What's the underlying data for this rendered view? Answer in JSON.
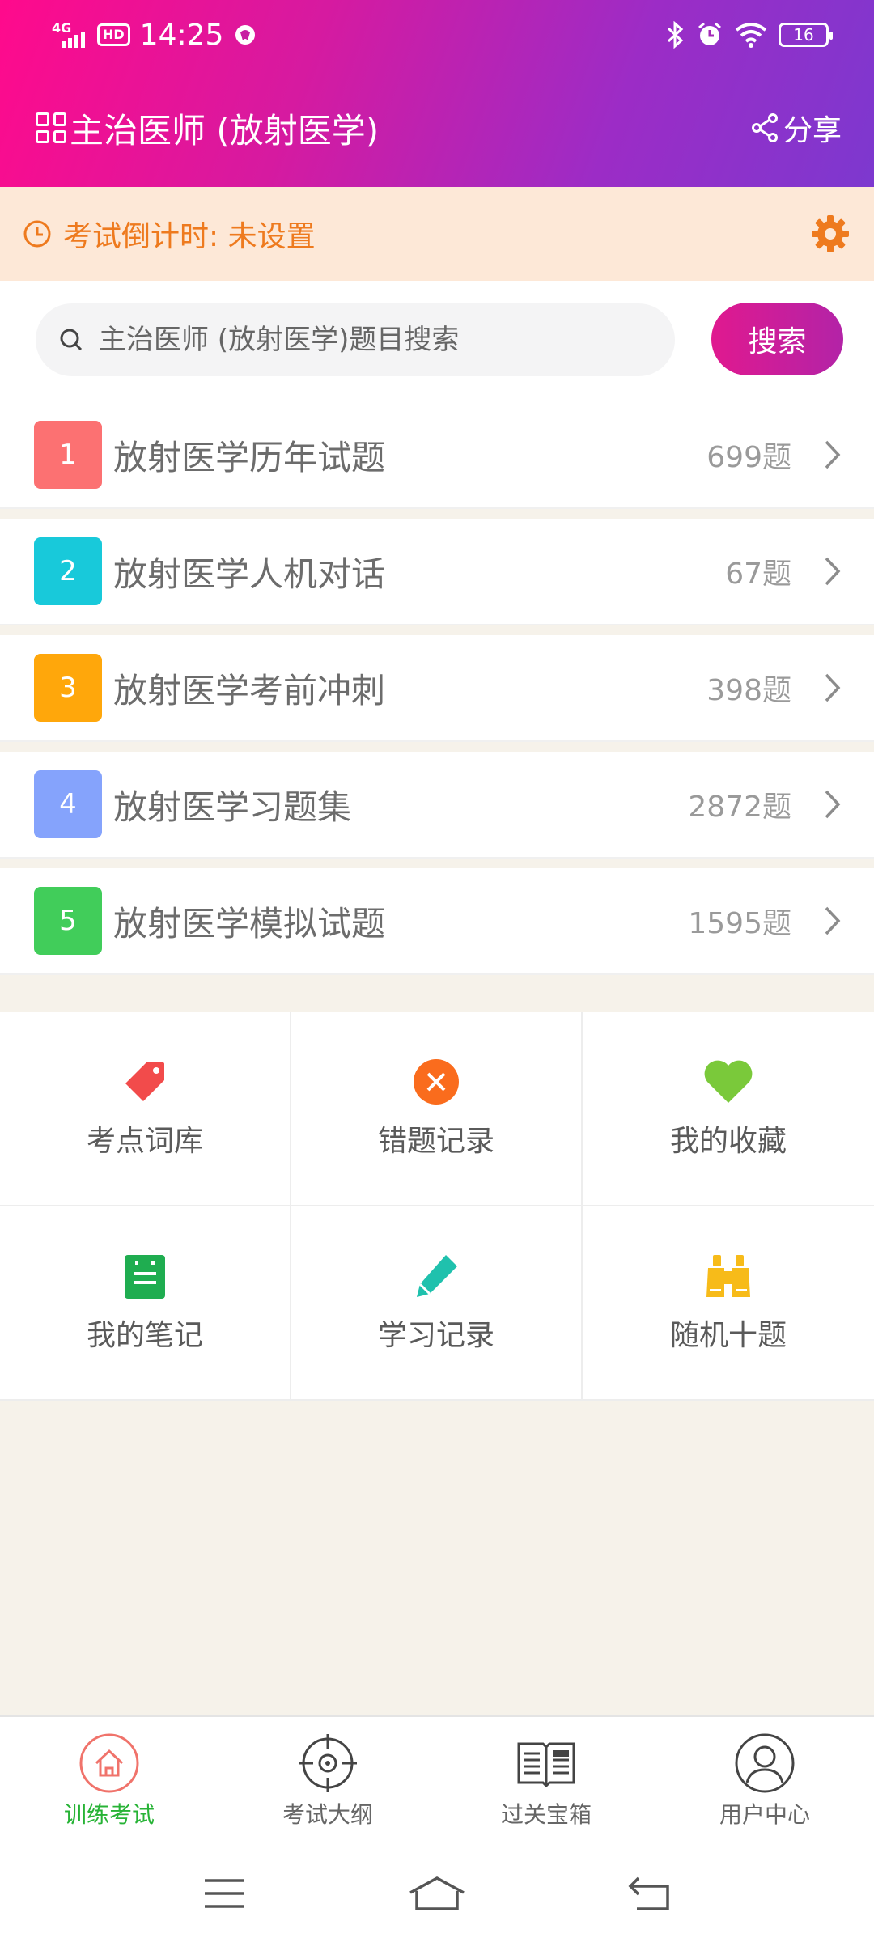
{
  "status": {
    "time": "14:25",
    "network": "4G",
    "hd": "HD",
    "battery": "16"
  },
  "header": {
    "title": "主治医师 (放射医学)",
    "share_label": "分享"
  },
  "countdown": {
    "label": "考试倒计时: 未设置"
  },
  "search": {
    "placeholder": "主治医师 (放射医学)题目搜索",
    "button_label": "搜索"
  },
  "list": [
    {
      "num": "1",
      "title": "放射医学历年试题",
      "count": "699题",
      "color": "#fc7172"
    },
    {
      "num": "2",
      "title": "放射医学人机对话",
      "count": "67题",
      "color": "#18c9da"
    },
    {
      "num": "3",
      "title": "放射医学考前冲刺",
      "count": "398题",
      "color": "#ffa70b"
    },
    {
      "num": "4",
      "title": "放射医学习题集",
      "count": "2872题",
      "color": "#85a3fc"
    },
    {
      "num": "5",
      "title": "放射医学模拟试题",
      "count": "1595题",
      "color": "#41cd5a"
    }
  ],
  "tools": [
    {
      "label": "考点词库",
      "icon": "tag-icon"
    },
    {
      "label": "错题记录",
      "icon": "wrong-circle-icon"
    },
    {
      "label": "我的收藏",
      "icon": "heart-icon"
    },
    {
      "label": "我的笔记",
      "icon": "notebook-icon"
    },
    {
      "label": "学习记录",
      "icon": "pencil-icon"
    },
    {
      "label": "随机十题",
      "icon": "binoculars-icon"
    }
  ],
  "tabs": [
    {
      "label": "训练考试",
      "icon": "home-icon",
      "active": true
    },
    {
      "label": "考试大纲",
      "icon": "target-icon",
      "active": false
    },
    {
      "label": "过关宝箱",
      "icon": "book-icon",
      "active": false
    },
    {
      "label": "用户中心",
      "icon": "user-icon",
      "active": false
    }
  ],
  "colors": {
    "accent": "#e0198f",
    "active_tab": "#27b336",
    "countdown": "#ee7a1e"
  }
}
